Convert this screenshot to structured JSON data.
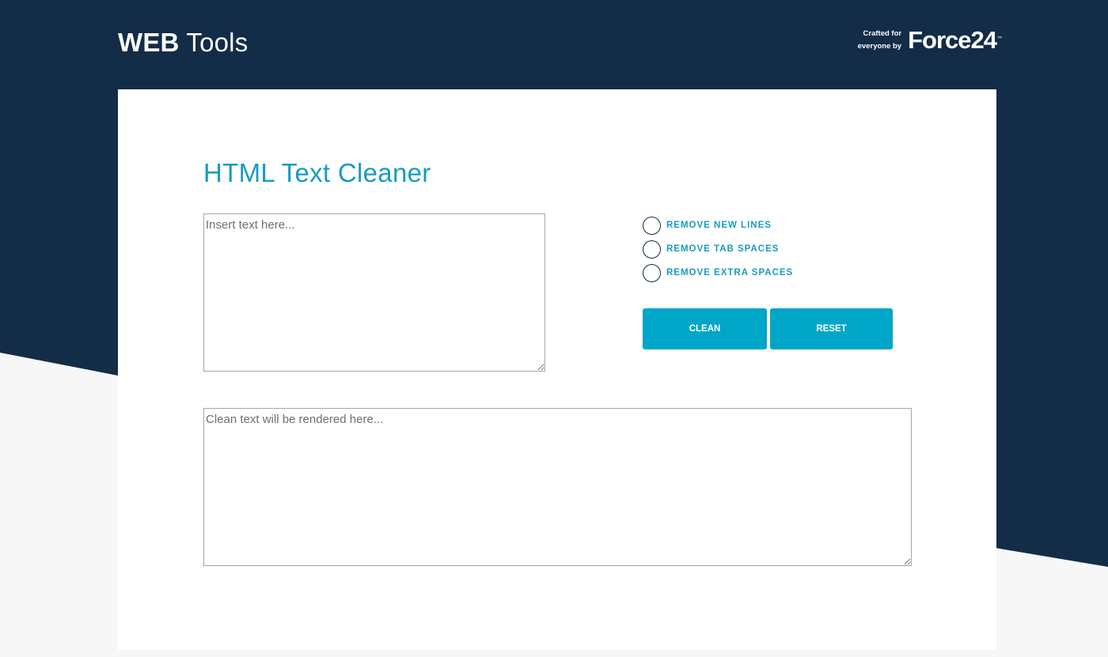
{
  "header": {
    "brand_bold": "WEB",
    "brand_light": "Tools",
    "crafted_line1": "Crafted for",
    "crafted_line2": "everyone by",
    "logo": "Force24",
    "logo_tm": "™"
  },
  "main": {
    "title": "HTML Text Cleaner",
    "input_placeholder": "Insert text here...",
    "output_placeholder": "Clean text will be rendered here...",
    "options": [
      {
        "label": "REMOVE NEW LINES",
        "checked": false
      },
      {
        "label": "REMOVE TAB SPACES",
        "checked": false
      },
      {
        "label": "REMOVE EXTRA SPACES",
        "checked": false
      }
    ],
    "clean_label": "CLEAN",
    "reset_label": "RESET"
  },
  "colors": {
    "navy": "#132c48",
    "accent": "#00a6c7",
    "title": "#1a9bbf",
    "background": "#f7f7f7"
  }
}
